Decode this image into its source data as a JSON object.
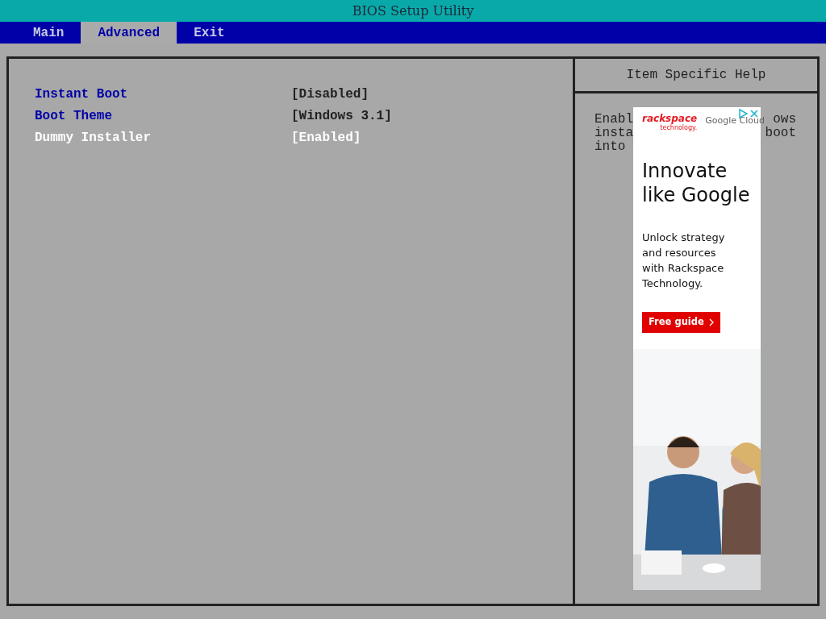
{
  "window": {
    "title": "BIOS Setup Utility"
  },
  "tabs": [
    {
      "label": "Main",
      "selected": false
    },
    {
      "label": "Advanced",
      "selected": true
    },
    {
      "label": "Exit",
      "selected": false
    }
  ],
  "settings": [
    {
      "label": "Instant Boot",
      "value": "[Disabled]",
      "selected": false
    },
    {
      "label": "Boot Theme",
      "value": "[Windows 3.1]",
      "selected": false
    },
    {
      "label": "Dummy Installer",
      "value": "[Enabled]",
      "selected": true
    }
  ],
  "help": {
    "title": "Item Specific Help",
    "lines": [
      {
        "left": "Enabl",
        "right": "ows"
      },
      {
        "left": "insta",
        "right": "boot"
      },
      {
        "left": "into"
      }
    ]
  },
  "ad": {
    "brand": "rackspace",
    "brand_sub": "technology.",
    "partner": "Google Cloud",
    "headline": "Innovate like Google",
    "body": "Unlock strategy and resources with Rackspace Technology.",
    "button": "Free guide"
  }
}
